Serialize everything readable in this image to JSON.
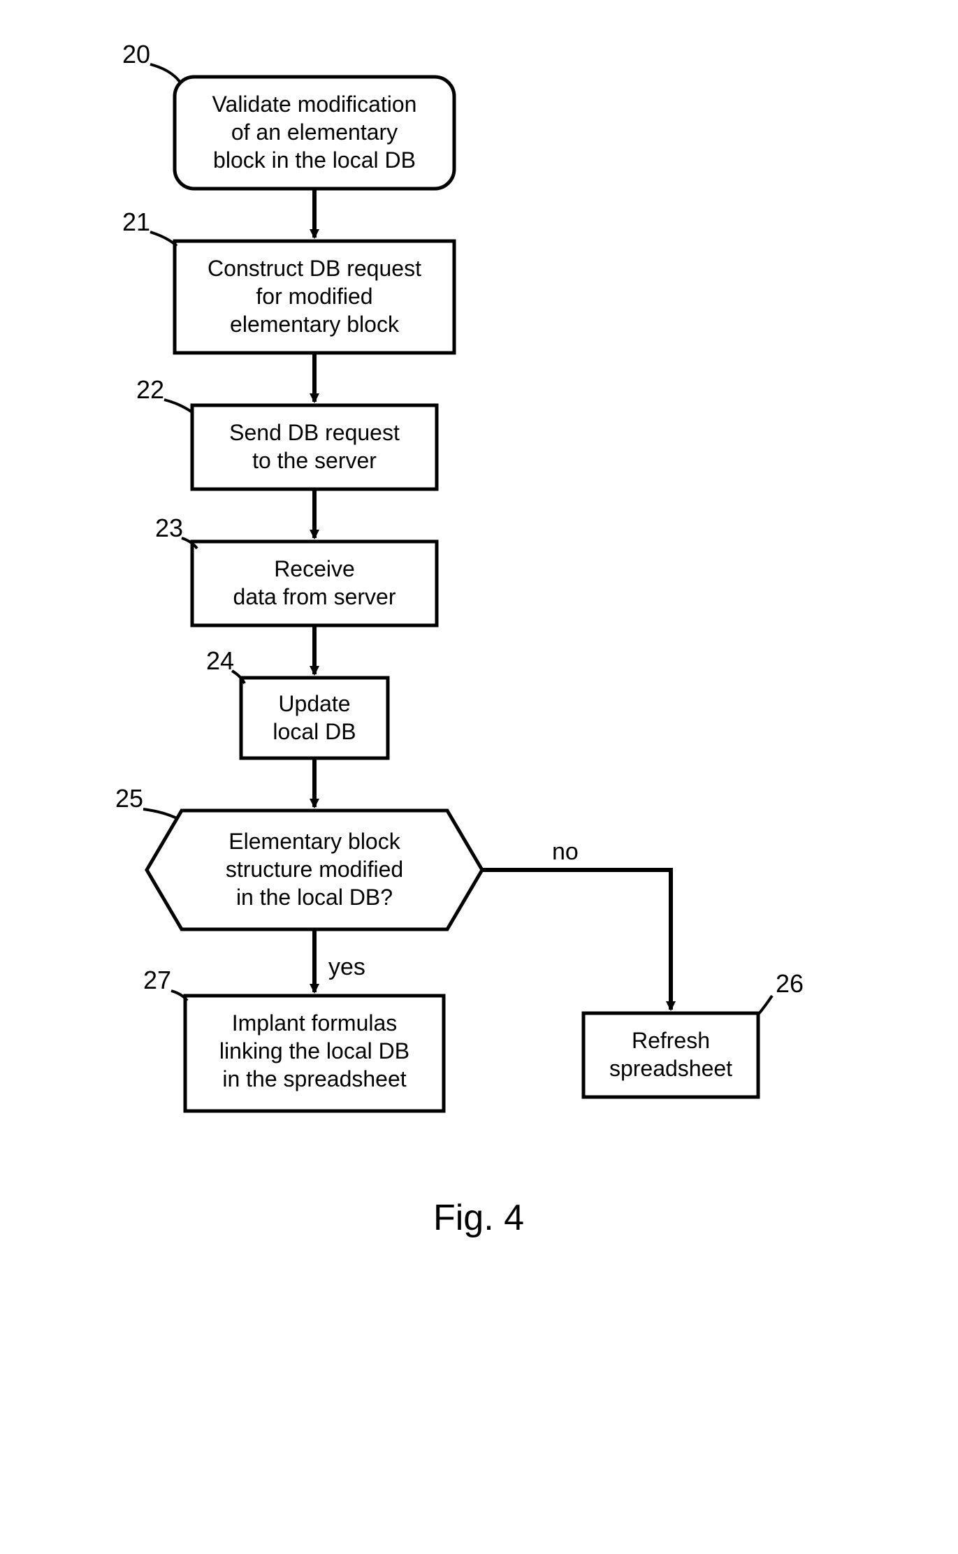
{
  "chart_data": {
    "type": "flowchart",
    "nodes": [
      {
        "id": "20",
        "shape": "rounded-terminator",
        "lines": [
          "Validate modification",
          "of an elementary",
          "block in the local DB"
        ]
      },
      {
        "id": "21",
        "shape": "process",
        "lines": [
          "Construct DB request",
          "for modified",
          "elementary block"
        ]
      },
      {
        "id": "22",
        "shape": "process",
        "lines": [
          "Send DB request",
          "to the server"
        ]
      },
      {
        "id": "23",
        "shape": "process",
        "lines": [
          "Receive",
          "data from server"
        ]
      },
      {
        "id": "24",
        "shape": "process",
        "lines": [
          "Update",
          "local DB"
        ]
      },
      {
        "id": "25",
        "shape": "decision-hex",
        "lines": [
          "Elementary block",
          "structure modified",
          "in the local DB?"
        ]
      },
      {
        "id": "27",
        "shape": "process",
        "lines": [
          "Implant formulas",
          "linking the local DB",
          "in the spreadsheet"
        ]
      },
      {
        "id": "26",
        "shape": "process",
        "lines": [
          "Refresh",
          "spreadsheet"
        ]
      }
    ],
    "edges": [
      {
        "from": "20",
        "to": "21"
      },
      {
        "from": "21",
        "to": "22"
      },
      {
        "from": "22",
        "to": "23"
      },
      {
        "from": "23",
        "to": "24"
      },
      {
        "from": "24",
        "to": "25"
      },
      {
        "from": "25",
        "to": "27",
        "label": "yes"
      },
      {
        "from": "25",
        "to": "26",
        "label": "no"
      }
    ],
    "figure_label": "Fig. 4"
  },
  "labels": {
    "n20": "20",
    "n21": "21",
    "n22": "22",
    "n23": "23",
    "n24": "24",
    "n25": "25",
    "n26": "26",
    "n27": "27",
    "yes": "yes",
    "no": "no",
    "fig": "Fig. 4"
  },
  "box20": {
    "l1": "Validate modification",
    "l2": "of an elementary",
    "l3": "block in the local DB"
  },
  "box21": {
    "l1": "Construct DB request",
    "l2": "for modified",
    "l3": "elementary block"
  },
  "box22": {
    "l1": "Send DB request",
    "l2": "to the server"
  },
  "box23": {
    "l1": "Receive",
    "l2": "data from server"
  },
  "box24": {
    "l1": "Update",
    "l2": "local DB"
  },
  "box25": {
    "l1": "Elementary block",
    "l2": "structure modified",
    "l3": "in the local DB?"
  },
  "box26": {
    "l1": "Refresh",
    "l2": "spreadsheet"
  },
  "box27": {
    "l1": "Implant formulas",
    "l2": "linking the local DB",
    "l3": "in the spreadsheet"
  }
}
